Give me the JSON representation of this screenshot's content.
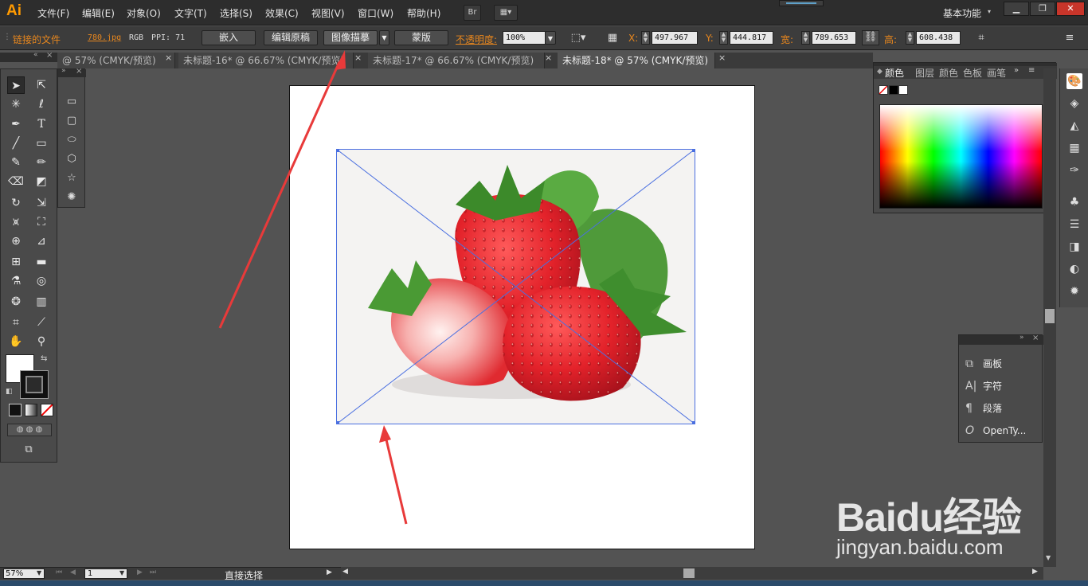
{
  "app": {
    "logo": "Ai",
    "workspace": "基本功能",
    "bridge_label": "Br"
  },
  "menu": [
    "文件(F)",
    "编辑(E)",
    "对象(O)",
    "文字(T)",
    "选择(S)",
    "效果(C)",
    "视图(V)",
    "窗口(W)",
    "帮助(H)"
  ],
  "control_bar": {
    "linked_file_label": "链接的文件",
    "file_name": "780.jpg",
    "color_mode": "RGB",
    "ppi": "PPI: 71",
    "embed_label": "嵌入",
    "edit_original_label": "编辑原稿",
    "image_trace_label": "图像描摹",
    "mask_label": "蒙版",
    "opacity_label": "不透明度:",
    "opacity_value": "100%",
    "x_label": "X:",
    "x_value": "497.967",
    "y_label": "Y:",
    "y_value": "444.817",
    "w_label": "宽:",
    "w_value": "789.653",
    "h_label": "高:",
    "h_value": "608.438"
  },
  "tabs": [
    {
      "label": "@ 57% (CMYK/预览)",
      "close": "×"
    },
    {
      "label": "未标题-16* @ 66.67% (CMYK/预览)",
      "close": "×"
    },
    {
      "label": "未标题-17* @ 66.67% (CMYK/预览)",
      "close": "×"
    },
    {
      "label": "未标题-18* @ 57% (CMYK/预览)",
      "close": "×"
    }
  ],
  "color_panel": {
    "tabs": [
      "颜色",
      "图层",
      "颜色",
      "色板",
      "画笔"
    ]
  },
  "text_panel": {
    "items": [
      {
        "icon": "artboard-icon",
        "label": "画板"
      },
      {
        "icon": "character-icon",
        "label": "字符"
      },
      {
        "icon": "paragraph-icon",
        "label": "段落"
      },
      {
        "icon": "opentype-icon",
        "label": "OpenTy..."
      }
    ]
  },
  "status": {
    "zoom": "57%",
    "page": "1",
    "tool_name": "直接选择"
  },
  "watermark": {
    "brand": "Baidu经验",
    "url": "jingyan.baidu.com"
  },
  "colors": {
    "accent_orange": "#e8871e",
    "annotation_red": "#e83a3a",
    "selection_blue": "#4a6fe0"
  }
}
